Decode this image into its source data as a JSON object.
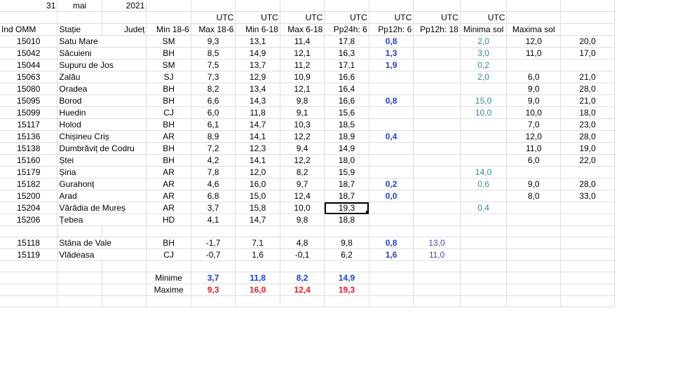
{
  "date": {
    "day": "31",
    "month": "mai",
    "year": "2021"
  },
  "utc_label": "UTC",
  "headers": [
    "Ind OMM",
    "Stație",
    "Județ",
    "Min 18-6",
    "Max 18-6",
    "Min 6-18",
    "Max 6-18",
    "Pp24h: 6",
    "Pp12h: 6",
    "Pp12h: 18",
    "Minima sol",
    "Maxima sol"
  ],
  "stations": [
    {
      "id": "15010",
      "name": "Satu Mare",
      "county": "SM",
      "min18": "9,3",
      "max18": "13,1",
      "min6": "11,4",
      "max6": "17,8",
      "pp24": "0,8",
      "pp12a": "",
      "pp12b": "2,0",
      "minsol": "12,0",
      "maxsol": "20,0"
    },
    {
      "id": "15042",
      "name": "Săcuieni",
      "county": "BH",
      "min18": "8,5",
      "max18": "14,9",
      "min6": "12,1",
      "max6": "16,3",
      "pp24": "1,3",
      "pp12a": "",
      "pp12b": "3,0",
      "minsol": "11,0",
      "maxsol": "17,0"
    },
    {
      "id": "15044",
      "name": "Supuru de Jos",
      "county": "SM",
      "min18": "7,5",
      "max18": "13,7",
      "min6": "11,2",
      "max6": "17,1",
      "pp24": "1,9",
      "pp12a": "",
      "pp12b": "0,2",
      "minsol": "",
      "maxsol": ""
    },
    {
      "id": "15063",
      "name": "Zalău",
      "county": "SJ",
      "min18": "7,3",
      "max18": "12,9",
      "min6": "10,9",
      "max6": "16,6",
      "pp24": "",
      "pp12a": "",
      "pp12b": "2,0",
      "minsol": "6,0",
      "maxsol": "21,0"
    },
    {
      "id": "15080",
      "name": "Oradea",
      "county": "BH",
      "min18": "8,2",
      "max18": "13,4",
      "min6": "12,1",
      "max6": "16,4",
      "pp24": "",
      "pp12a": "",
      "pp12b": "",
      "minsol": "9,0",
      "maxsol": "28,0"
    },
    {
      "id": "15095",
      "name": "Borod",
      "county": "BH",
      "min18": "6,6",
      "max18": "14,3",
      "min6": "9,8",
      "max6": "16,6",
      "pp24": "0,8",
      "pp12a": "",
      "pp12b": "15,0",
      "minsol": "9,0",
      "maxsol": "21,0"
    },
    {
      "id": "15099",
      "name": "Huedin",
      "county": "CJ",
      "min18": "6,0",
      "max18": "11,8",
      "min6": "9,1",
      "max6": "15,6",
      "pp24": "",
      "pp12a": "",
      "pp12b": "10,0",
      "minsol": "10,0",
      "maxsol": "18,0"
    },
    {
      "id": "15117",
      "name": "Holod",
      "county": "BH",
      "min18": "6,1",
      "max18": "14,7",
      "min6": "10,3",
      "max6": "18,5",
      "pp24": "",
      "pp12a": "",
      "pp12b": "",
      "minsol": "7,0",
      "maxsol": "23,0"
    },
    {
      "id": "15136",
      "name": "Chișineu   Criș",
      "county": "AR",
      "min18": "8,9",
      "max18": "14,1",
      "min6": "12,2",
      "max6": "18,9",
      "pp24": "0,4",
      "pp12a": "",
      "pp12b": "",
      "minsol": "12,0",
      "maxsol": "28,0"
    },
    {
      "id": "15138",
      "name": "Dumbrăviț  de Codru",
      "county": "BH",
      "min18": "7,2",
      "max18": "12,3",
      "min6": "9,4",
      "max6": "14,9",
      "pp24": "",
      "pp12a": "",
      "pp12b": "",
      "minsol": "11,0",
      "maxsol": "19,0"
    },
    {
      "id": "15160",
      "name": "Ștei",
      "county": "BH",
      "min18": "4,2",
      "max18": "14,1",
      "min6": "12,2",
      "max6": "18,0",
      "pp24": "",
      "pp12a": "",
      "pp12b": "",
      "minsol": "6,0",
      "maxsol": "22,0"
    },
    {
      "id": "15179",
      "name": "Șiria",
      "county": "AR",
      "min18": "7,8",
      "max18": "12,0",
      "min6": "8,2",
      "max6": "15,9",
      "pp24": "",
      "pp12a": "",
      "pp12b": "14,0",
      "minsol": "",
      "maxsol": ""
    },
    {
      "id": "15182",
      "name": "Gurahonț",
      "county": "AR",
      "min18": "4,6",
      "max18": "16,0",
      "min6": "9,7",
      "max6": "18,7",
      "pp24": "0,2",
      "pp12a": "",
      "pp12b": "0,6",
      "minsol": "9,0",
      "maxsol": "28,0"
    },
    {
      "id": "15200",
      "name": "Arad",
      "county": "AR",
      "min18": "6,8",
      "max18": "15,0",
      "min6": "12,4",
      "max6": "18,7",
      "pp24": "0,0",
      "pp12a": "",
      "pp12b": "",
      "minsol": "8,0",
      "maxsol": "33,0"
    },
    {
      "id": "15204",
      "name": "Vărădia de Mureș",
      "county": "AR",
      "min18": "3,7",
      "max18": "15,8",
      "min6": "10,0",
      "max6": "19,3",
      "pp24": "",
      "pp12a": "",
      "pp12b": "0,4",
      "minsol": "",
      "maxsol": ""
    },
    {
      "id": "15206",
      "name": "Țebea",
      "county": "HD",
      "min18": "4,1",
      "max18": "14,7",
      "min6": "9,8",
      "max6": "18,8",
      "pp24": "",
      "pp12a": "",
      "pp12b": "",
      "minsol": "",
      "maxsol": ""
    }
  ],
  "mountain_stations": [
    {
      "id": "15118",
      "name": "Stâna de Vale",
      "county": "BH",
      "min18": "-1,7",
      "max18": "7,1",
      "min6": "4,8",
      "max6": "9,8",
      "pp24": "0,8",
      "pp12a": "13,0",
      "pp12b": "",
      "minsol": "",
      "maxsol": ""
    },
    {
      "id": "15119",
      "name": "Vlădeasa",
      "county": "CJ",
      "min18": "-0,7",
      "max18": "1,6",
      "min6": "-0,1",
      "max6": "6,2",
      "pp24": "1,6",
      "pp12a": "11,0",
      "pp12b": "",
      "minsol": "",
      "maxsol": ""
    }
  ],
  "summary": {
    "min_label": "Minime",
    "max_label": "Maxime",
    "min": [
      "3,7",
      "11,8",
      "8,2",
      "14,9"
    ],
    "max": [
      "9,3",
      "16,0",
      "12,4",
      "19,3"
    ]
  },
  "selected_cell": "15204.max6",
  "colors": {
    "pp24": "#1f3fd6",
    "pp12_18": "#2a8c96",
    "pp12_6": "#4444bb",
    "maxime": "#e0202a",
    "grid": "#d9dde3"
  }
}
